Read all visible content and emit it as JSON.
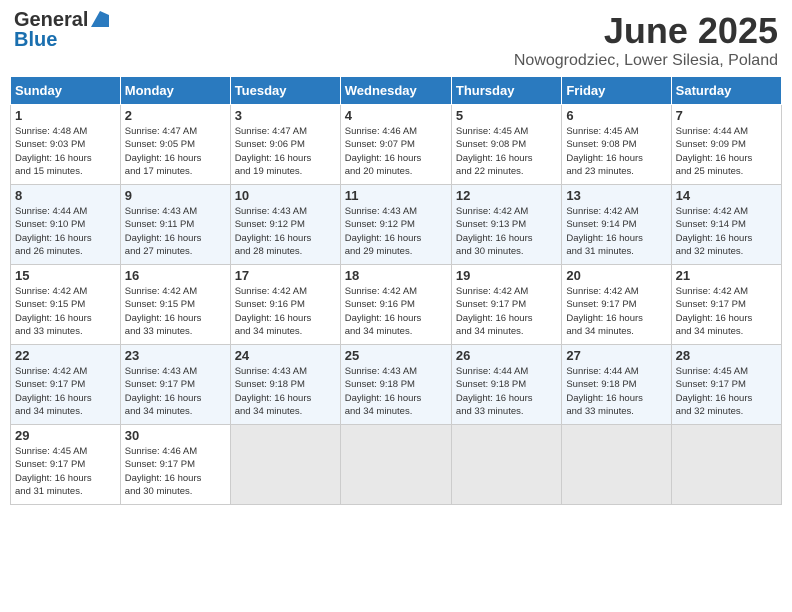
{
  "header": {
    "logo_general": "General",
    "logo_blue": "Blue",
    "month_title": "June 2025",
    "location": "Nowogrodziec, Lower Silesia, Poland"
  },
  "days_of_week": [
    "Sunday",
    "Monday",
    "Tuesday",
    "Wednesday",
    "Thursday",
    "Friday",
    "Saturday"
  ],
  "weeks": [
    [
      {
        "day": "1",
        "info": "Sunrise: 4:48 AM\nSunset: 9:03 PM\nDaylight: 16 hours\nand 15 minutes."
      },
      {
        "day": "2",
        "info": "Sunrise: 4:47 AM\nSunset: 9:05 PM\nDaylight: 16 hours\nand 17 minutes."
      },
      {
        "day": "3",
        "info": "Sunrise: 4:47 AM\nSunset: 9:06 PM\nDaylight: 16 hours\nand 19 minutes."
      },
      {
        "day": "4",
        "info": "Sunrise: 4:46 AM\nSunset: 9:07 PM\nDaylight: 16 hours\nand 20 minutes."
      },
      {
        "day": "5",
        "info": "Sunrise: 4:45 AM\nSunset: 9:08 PM\nDaylight: 16 hours\nand 22 minutes."
      },
      {
        "day": "6",
        "info": "Sunrise: 4:45 AM\nSunset: 9:08 PM\nDaylight: 16 hours\nand 23 minutes."
      },
      {
        "day": "7",
        "info": "Sunrise: 4:44 AM\nSunset: 9:09 PM\nDaylight: 16 hours\nand 25 minutes."
      }
    ],
    [
      {
        "day": "8",
        "info": "Sunrise: 4:44 AM\nSunset: 9:10 PM\nDaylight: 16 hours\nand 26 minutes."
      },
      {
        "day": "9",
        "info": "Sunrise: 4:43 AM\nSunset: 9:11 PM\nDaylight: 16 hours\nand 27 minutes."
      },
      {
        "day": "10",
        "info": "Sunrise: 4:43 AM\nSunset: 9:12 PM\nDaylight: 16 hours\nand 28 minutes."
      },
      {
        "day": "11",
        "info": "Sunrise: 4:43 AM\nSunset: 9:12 PM\nDaylight: 16 hours\nand 29 minutes."
      },
      {
        "day": "12",
        "info": "Sunrise: 4:42 AM\nSunset: 9:13 PM\nDaylight: 16 hours\nand 30 minutes."
      },
      {
        "day": "13",
        "info": "Sunrise: 4:42 AM\nSunset: 9:14 PM\nDaylight: 16 hours\nand 31 minutes."
      },
      {
        "day": "14",
        "info": "Sunrise: 4:42 AM\nSunset: 9:14 PM\nDaylight: 16 hours\nand 32 minutes."
      }
    ],
    [
      {
        "day": "15",
        "info": "Sunrise: 4:42 AM\nSunset: 9:15 PM\nDaylight: 16 hours\nand 33 minutes."
      },
      {
        "day": "16",
        "info": "Sunrise: 4:42 AM\nSunset: 9:15 PM\nDaylight: 16 hours\nand 33 minutes."
      },
      {
        "day": "17",
        "info": "Sunrise: 4:42 AM\nSunset: 9:16 PM\nDaylight: 16 hours\nand 34 minutes."
      },
      {
        "day": "18",
        "info": "Sunrise: 4:42 AM\nSunset: 9:16 PM\nDaylight: 16 hours\nand 34 minutes."
      },
      {
        "day": "19",
        "info": "Sunrise: 4:42 AM\nSunset: 9:17 PM\nDaylight: 16 hours\nand 34 minutes."
      },
      {
        "day": "20",
        "info": "Sunrise: 4:42 AM\nSunset: 9:17 PM\nDaylight: 16 hours\nand 34 minutes."
      },
      {
        "day": "21",
        "info": "Sunrise: 4:42 AM\nSunset: 9:17 PM\nDaylight: 16 hours\nand 34 minutes."
      }
    ],
    [
      {
        "day": "22",
        "info": "Sunrise: 4:42 AM\nSunset: 9:17 PM\nDaylight: 16 hours\nand 34 minutes."
      },
      {
        "day": "23",
        "info": "Sunrise: 4:43 AM\nSunset: 9:17 PM\nDaylight: 16 hours\nand 34 minutes."
      },
      {
        "day": "24",
        "info": "Sunrise: 4:43 AM\nSunset: 9:18 PM\nDaylight: 16 hours\nand 34 minutes."
      },
      {
        "day": "25",
        "info": "Sunrise: 4:43 AM\nSunset: 9:18 PM\nDaylight: 16 hours\nand 34 minutes."
      },
      {
        "day": "26",
        "info": "Sunrise: 4:44 AM\nSunset: 9:18 PM\nDaylight: 16 hours\nand 33 minutes."
      },
      {
        "day": "27",
        "info": "Sunrise: 4:44 AM\nSunset: 9:18 PM\nDaylight: 16 hours\nand 33 minutes."
      },
      {
        "day": "28",
        "info": "Sunrise: 4:45 AM\nSunset: 9:17 PM\nDaylight: 16 hours\nand 32 minutes."
      }
    ],
    [
      {
        "day": "29",
        "info": "Sunrise: 4:45 AM\nSunset: 9:17 PM\nDaylight: 16 hours\nand 31 minutes."
      },
      {
        "day": "30",
        "info": "Sunrise: 4:46 AM\nSunset: 9:17 PM\nDaylight: 16 hours\nand 30 minutes."
      },
      null,
      null,
      null,
      null,
      null
    ]
  ]
}
